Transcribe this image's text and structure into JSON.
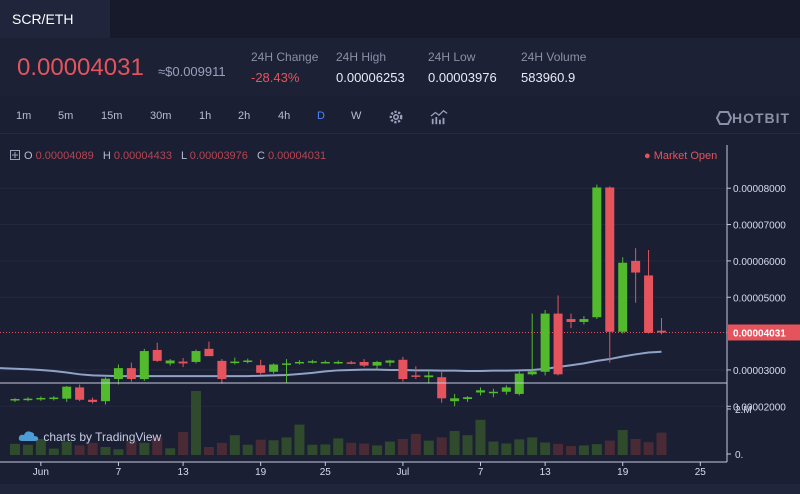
{
  "pair": "SCR/ETH",
  "ticker": {
    "last_price": "0.00004031",
    "fiat_price": "≈$0.009911",
    "change_label": "24H Change",
    "change_value": "-28.43%",
    "high_label": "24H High",
    "high_value": "0.00006253",
    "low_label": "24H Low",
    "low_value": "0.00003976",
    "volume_label": "24H Volume",
    "volume_value": "583960.9"
  },
  "timeframes": [
    "1m",
    "5m",
    "15m",
    "30m",
    "1h",
    "2h",
    "4h",
    "D",
    "W"
  ],
  "active_timeframe": "D",
  "brand": "HOTBIT",
  "ohlc": {
    "o_label": "O",
    "o": "0.00004089",
    "h_label": "H",
    "h": "0.00004433",
    "l_label": "L",
    "l": "0.00003976",
    "c_label": "C",
    "c": "0.00004031"
  },
  "market_status": "Market Open",
  "tradingview": "charts by TradingView",
  "icons": {
    "settings": "gear-icon",
    "indicators": "indicators-icon",
    "expand": "plus-box-icon",
    "cloud": "cloud-icon"
  },
  "colors": {
    "up": "#53b92d",
    "down": "#e5545c",
    "ma": "#8ea3c7",
    "bg": "#1b1f33"
  },
  "chart_data": {
    "type": "candlestick",
    "price_axis_ticks": [
      "0.00008000",
      "0.00007000",
      "0.00006000",
      "0.00005000",
      "0.00004031",
      "0.00003000",
      "0.00002000"
    ],
    "price_ticks_values": [
      8e-05,
      7e-05,
      6e-05,
      5e-05,
      3e-05,
      2e-05
    ],
    "last_price_value": 4.031e-05,
    "volume_axis_ticks": [
      "2.M",
      "0."
    ],
    "x_ticks": [
      "Jun",
      "7",
      "13",
      "19",
      "25",
      "Jul",
      "7",
      "13",
      "19",
      "25"
    ],
    "candles": [
      {
        "o": 2.18e-05,
        "h": 2.22e-05,
        "l": 2.12e-05,
        "c": 2.2e-05
      },
      {
        "o": 2.2e-05,
        "h": 2.25e-05,
        "l": 2.14e-05,
        "c": 2.21e-05
      },
      {
        "o": 2.21e-05,
        "h": 2.27e-05,
        "l": 2.15e-05,
        "c": 2.23e-05
      },
      {
        "o": 2.23e-05,
        "h": 2.28e-05,
        "l": 2.16e-05,
        "c": 2.24e-05
      },
      {
        "o": 2.21e-05,
        "h": 2.56e-05,
        "l": 2.12e-05,
        "c": 2.54e-05
      },
      {
        "o": 2.52e-05,
        "h": 2.6e-05,
        "l": 2.14e-05,
        "c": 2.18e-05
      },
      {
        "o": 2.18e-05,
        "h": 2.24e-05,
        "l": 2.08e-05,
        "c": 2.12e-05
      },
      {
        "o": 2.14e-05,
        "h": 2.8e-05,
        "l": 2.05e-05,
        "c": 2.76e-05
      },
      {
        "o": 2.75e-05,
        "h": 3.15e-05,
        "l": 2.6e-05,
        "c": 3.05e-05
      },
      {
        "o": 3.05e-05,
        "h": 3.2e-05,
        "l": 2.68e-05,
        "c": 2.75e-05
      },
      {
        "o": 2.75e-05,
        "h": 3.58e-05,
        "l": 2.7e-05,
        "c": 3.52e-05
      },
      {
        "o": 3.55e-05,
        "h": 3.75e-05,
        "l": 3.22e-05,
        "c": 3.25e-05
      },
      {
        "o": 3.18e-05,
        "h": 3.3e-05,
        "l": 3.12e-05,
        "c": 3.26e-05
      },
      {
        "o": 3.23e-05,
        "h": 3.33e-05,
        "l": 3.08e-05,
        "c": 3.18e-05
      },
      {
        "o": 3.22e-05,
        "h": 3.56e-05,
        "l": 3.18e-05,
        "c": 3.52e-05
      },
      {
        "o": 3.58e-05,
        "h": 3.78e-05,
        "l": 3.4e-05,
        "c": 3.38e-05
      },
      {
        "o": 3.25e-05,
        "h": 3.3e-05,
        "l": 2.62e-05,
        "c": 2.75e-05
      },
      {
        "o": 3.22e-05,
        "h": 3.34e-05,
        "l": 3.15e-05,
        "c": 3.23e-05
      },
      {
        "o": 3.25e-05,
        "h": 3.31e-05,
        "l": 3.18e-05,
        "c": 3.26e-05
      },
      {
        "o": 3.13e-05,
        "h": 3.28e-05,
        "l": 2.88e-05,
        "c": 2.92e-05
      },
      {
        "o": 2.95e-05,
        "h": 3.18e-05,
        "l": 2.9e-05,
        "c": 3.15e-05
      },
      {
        "o": 3.14e-05,
        "h": 3.3e-05,
        "l": 2.65e-05,
        "c": 3.18e-05
      },
      {
        "o": 3.19e-05,
        "h": 3.27e-05,
        "l": 3.15e-05,
        "c": 3.22e-05
      },
      {
        "o": 3.22e-05,
        "h": 3.28e-05,
        "l": 3.18e-05,
        "c": 3.24e-05
      },
      {
        "o": 3.22e-05,
        "h": 3.26e-05,
        "l": 3.18e-05,
        "c": 3.22e-05
      },
      {
        "o": 3.21e-05,
        "h": 3.26e-05,
        "l": 3.16e-05,
        "c": 3.22e-05
      },
      {
        "o": 3.21e-05,
        "h": 3.25e-05,
        "l": 3.16e-05,
        "c": 3.2e-05
      },
      {
        "o": 3.22e-05,
        "h": 3.3e-05,
        "l": 3.08e-05,
        "c": 3.12e-05
      },
      {
        "o": 3.12e-05,
        "h": 3.25e-05,
        "l": 3.02e-05,
        "c": 3.22e-05
      },
      {
        "o": 3.2e-05,
        "h": 3.28e-05,
        "l": 3.1e-05,
        "c": 3.26e-05
      },
      {
        "o": 3.28e-05,
        "h": 3.36e-05,
        "l": 2.68e-05,
        "c": 2.75e-05
      },
      {
        "o": 2.85e-05,
        "h": 3.1e-05,
        "l": 2.75e-05,
        "c": 2.83e-05
      },
      {
        "o": 2.8e-05,
        "h": 2.98e-05,
        "l": 2.62e-05,
        "c": 2.85e-05
      },
      {
        "o": 2.8e-05,
        "h": 2.98e-05,
        "l": 2.1e-05,
        "c": 2.22e-05
      },
      {
        "o": 2.14e-05,
        "h": 2.34e-05,
        "l": 2e-05,
        "c": 2.22e-05
      },
      {
        "o": 2.2e-05,
        "h": 2.28e-05,
        "l": 2.12e-05,
        "c": 2.25e-05
      },
      {
        "o": 2.38e-05,
        "h": 2.52e-05,
        "l": 2.3e-05,
        "c": 2.44e-05
      },
      {
        "o": 2.36e-05,
        "h": 2.48e-05,
        "l": 2.25e-05,
        "c": 2.4e-05
      },
      {
        "o": 2.4e-05,
        "h": 2.58e-05,
        "l": 2.32e-05,
        "c": 2.52e-05
      },
      {
        "o": 2.34e-05,
        "h": 2.96e-05,
        "l": 2.3e-05,
        "c": 2.9e-05
      },
      {
        "o": 2.88e-05,
        "h": 4.55e-05,
        "l": 2.85e-05,
        "c": 2.96e-05
      },
      {
        "o": 2.95e-05,
        "h": 4.65e-05,
        "l": 2.85e-05,
        "c": 4.55e-05
      },
      {
        "o": 4.55e-05,
        "h": 5.05e-05,
        "l": 2.85e-05,
        "c": 2.88e-05
      },
      {
        "o": 4.4e-05,
        "h": 4.55e-05,
        "l": 4.15e-05,
        "c": 4.32e-05
      },
      {
        "o": 4.32e-05,
        "h": 4.48e-05,
        "l": 4.25e-05,
        "c": 4.4e-05
      },
      {
        "o": 4.45e-05,
        "h": 8.1e-05,
        "l": 4.4e-05,
        "c": 8.02e-05
      },
      {
        "o": 8.02e-05,
        "h": 8.05e-05,
        "l": 3.2e-05,
        "c": 4.05e-05
      },
      {
        "o": 4.05e-05,
        "h": 6.1e-05,
        "l": 4e-05,
        "c": 5.95e-05
      },
      {
        "o": 6e-05,
        "h": 6.35e-05,
        "l": 4.85e-05,
        "c": 5.68e-05
      },
      {
        "o": 5.6e-05,
        "h": 6.3e-05,
        "l": 4e-05,
        "c": 4.02e-05
      },
      {
        "o": 4.08e-05,
        "h": 4.43e-05,
        "l": 3.98e-05,
        "c": 4.03e-05
      }
    ],
    "ma": [
      3.05e-05,
      3.02e-05,
      3e-05,
      2.97e-05,
      2.93e-05,
      2.88e-05,
      2.85e-05,
      2.84e-05,
      2.83e-05,
      2.83e-05,
      2.83e-05,
      2.83e-05,
      2.83e-05,
      2.83e-05,
      2.83e-05,
      2.83e-05,
      2.83e-05,
      2.83e-05,
      2.83e-05,
      2.84e-05,
      2.85e-05,
      2.86e-05,
      2.89e-05,
      2.92e-05,
      2.96e-05,
      2.99e-05,
      3e-05,
      3.01e-05,
      3.01e-05,
      3e-05,
      3e-05,
      2.99e-05,
      2.99e-05,
      2.98e-05,
      2.98e-05,
      2.97e-05,
      2.97e-05,
      2.98e-05,
      2.98e-05,
      2.99e-05,
      3e-05,
      3.03e-05,
      3.08e-05,
      3.13e-05,
      3.18e-05,
      3.25e-05,
      3.3e-05,
      3.37e-05,
      3.43e-05,
      3.48e-05,
      3.5e-05
    ],
    "volumes": [
      0.35,
      0.32,
      0.5,
      0.2,
      0.42,
      0.3,
      0.38,
      0.25,
      0.18,
      0.44,
      0.38,
      0.55,
      0.21,
      0.72,
      2.0,
      0.25,
      0.38,
      0.62,
      0.32,
      0.48,
      0.46,
      0.55,
      0.95,
      0.32,
      0.33,
      0.52,
      0.38,
      0.36,
      0.3,
      0.42,
      0.5,
      0.66,
      0.45,
      0.55,
      0.75,
      0.62,
      1.1,
      0.42,
      0.36,
      0.49,
      0.55,
      0.39,
      0.35,
      0.28,
      0.3,
      0.34,
      0.45,
      0.78,
      0.5,
      0.4,
      0.7
    ]
  }
}
